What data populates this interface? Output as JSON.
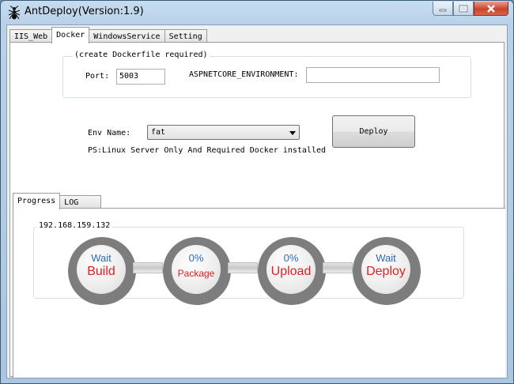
{
  "window": {
    "title": "AntDeploy(Version:1.9)"
  },
  "main_tabs": [
    {
      "label": "IIS_Web"
    },
    {
      "label": "Docker"
    },
    {
      "label": "WindowsService"
    },
    {
      "label": "Setting"
    }
  ],
  "docker": {
    "group_label": "(create Dockerfile required)",
    "port_label": "Port:",
    "port_value": "5003",
    "env_var_label": "ASPNETCORE_ENVIRONMENT:",
    "env_var_value": "",
    "env_name_label": "Env Name:",
    "env_name_value": "fat",
    "deploy_button": "Deploy",
    "note": "PS:Linux Server Only And Required Docker installed"
  },
  "progress_tabs": [
    {
      "label": "Progress"
    },
    {
      "label": "LOG"
    }
  ],
  "progress": {
    "server": "192.168.159.132",
    "stages": [
      {
        "status": "Wait",
        "name": "Build"
      },
      {
        "status": "0%",
        "name": "Package"
      },
      {
        "status": "0%",
        "name": "Upload"
      },
      {
        "status": "Wait",
        "name": "Deploy"
      }
    ]
  },
  "colors": {
    "status_blue": "#2a6bb5",
    "stage_red": "#e02020",
    "ring_gray": "#7d7d7d"
  }
}
